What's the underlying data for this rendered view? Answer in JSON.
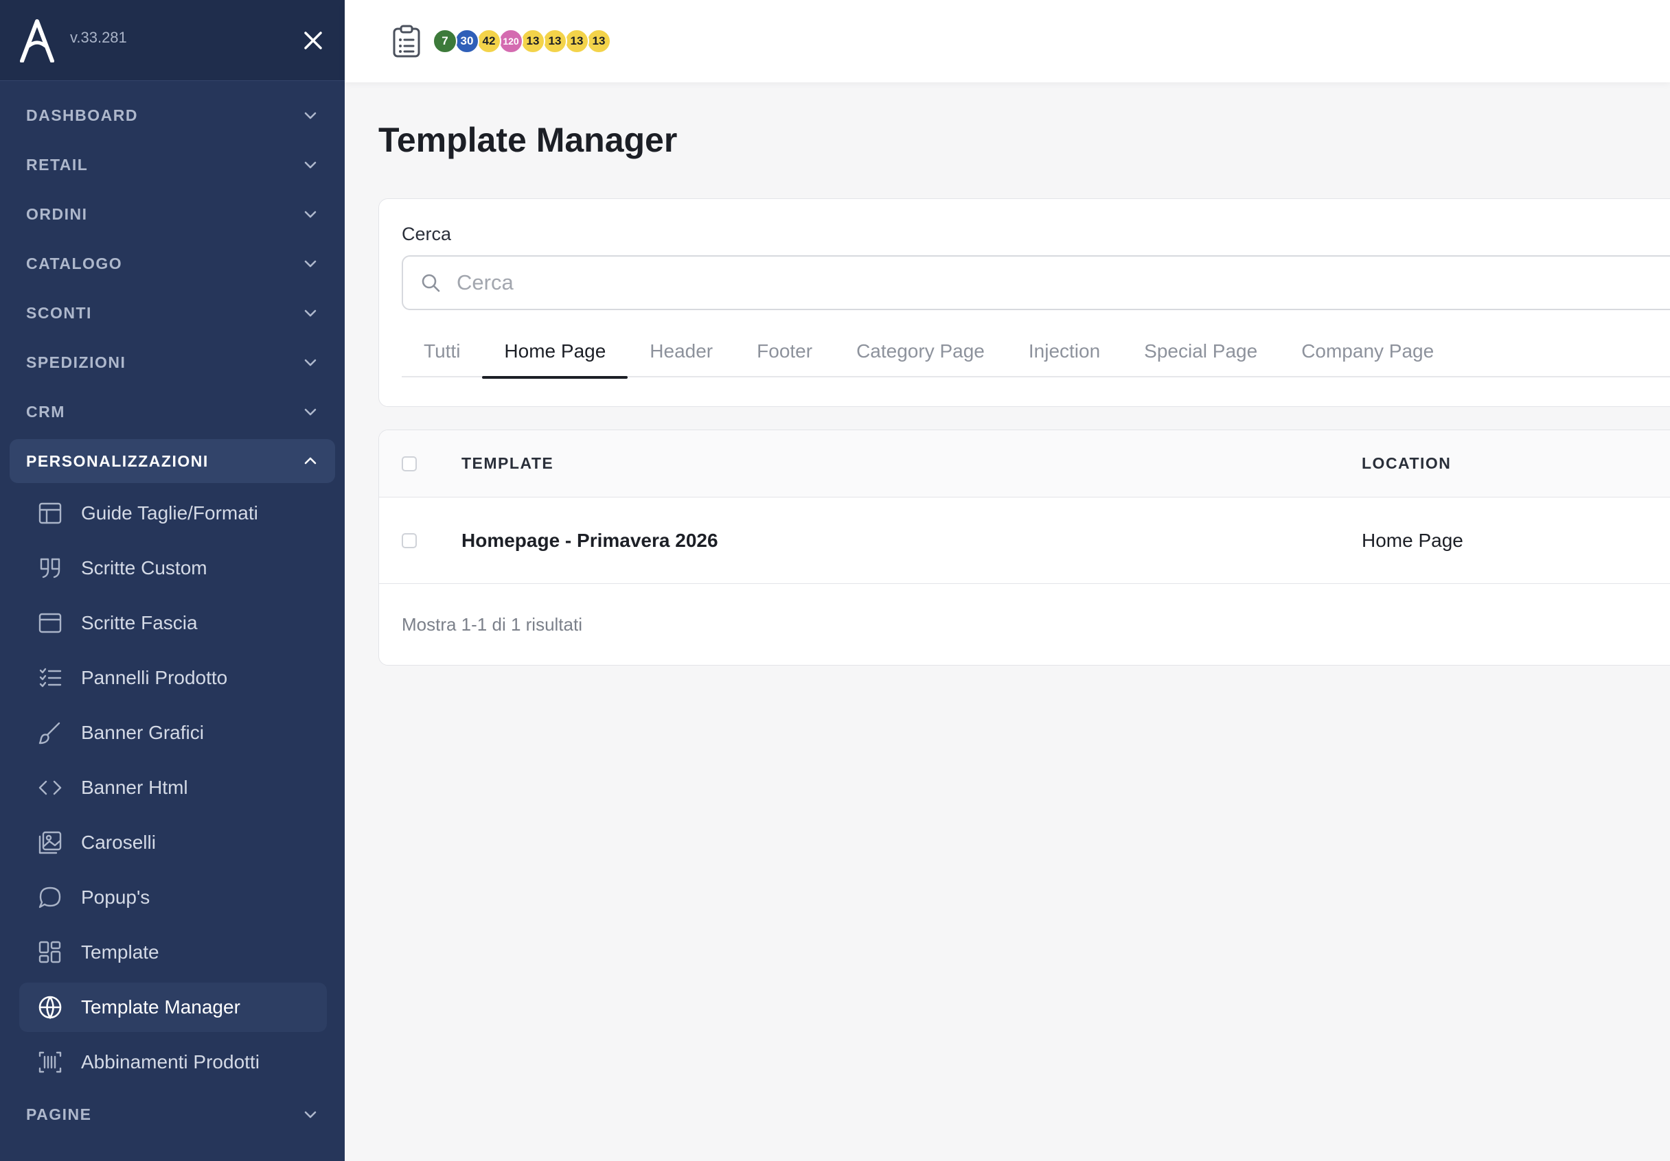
{
  "app": {
    "version": "v.33.281"
  },
  "sidebar": {
    "groups_top": [
      {
        "label": "DASHBOARD"
      },
      {
        "label": "RETAIL"
      },
      {
        "label": "ORDINI"
      },
      {
        "label": "CATALOGO"
      },
      {
        "label": "SCONTI"
      },
      {
        "label": "SPEDIZIONI"
      },
      {
        "label": "CRM"
      }
    ],
    "open_group": {
      "label": "PERSONALIZZAZIONI"
    },
    "sub_items": [
      {
        "label": "Guide Taglie/Formati",
        "icon": "table-icon"
      },
      {
        "label": "Scritte Custom",
        "icon": "quote-icon"
      },
      {
        "label": "Scritte Fascia",
        "icon": "panel-icon"
      },
      {
        "label": "Pannelli Prodotto",
        "icon": "list-icon"
      },
      {
        "label": "Banner Grafici",
        "icon": "brush-icon"
      },
      {
        "label": "Banner Html",
        "icon": "code-icon"
      },
      {
        "label": "Caroselli",
        "icon": "images-icon"
      },
      {
        "label": "Popup's",
        "icon": "chat-bubble-icon"
      },
      {
        "label": "Template",
        "icon": "layout-icon"
      },
      {
        "label": "Template Manager",
        "icon": "globe-icon",
        "active": true
      },
      {
        "label": "Abbinamenti Prodotti",
        "icon": "barcode-icon"
      }
    ],
    "groups_bottom": [
      {
        "label": "PAGINE"
      }
    ]
  },
  "topbar": {
    "badges": [
      {
        "value": "7",
        "color": "#3d7a3a",
        "text_color": "#ffffff"
      },
      {
        "value": "30",
        "color": "#2f5fb8",
        "text_color": "#ffffff"
      },
      {
        "value": "42",
        "color": "#f3d34a",
        "text_color": "#1c1f26"
      },
      {
        "value": "120",
        "color": "#d46bb0",
        "text_color": "#ffffff"
      },
      {
        "value": "13",
        "color": "#f3d34a",
        "text_color": "#1c1f26"
      },
      {
        "value": "13",
        "color": "#f3d34a",
        "text_color": "#1c1f26"
      },
      {
        "value": "13",
        "color": "#f3d34a",
        "text_color": "#1c1f26"
      },
      {
        "value": "13",
        "color": "#f3d34a",
        "text_color": "#1c1f26"
      }
    ]
  },
  "page": {
    "title": "Template Manager"
  },
  "search": {
    "label": "Cerca",
    "placeholder": "Cerca",
    "value": ""
  },
  "tabs": [
    {
      "label": "Tutti"
    },
    {
      "label": "Home Page",
      "active": true
    },
    {
      "label": "Header"
    },
    {
      "label": "Footer"
    },
    {
      "label": "Category Page"
    },
    {
      "label": "Injection"
    },
    {
      "label": "Special Page"
    },
    {
      "label": "Company Page"
    }
  ],
  "table": {
    "columns": {
      "template": "TEMPLATE",
      "location": "LOCATION"
    },
    "rows": [
      {
        "template": "Homepage - Primavera 2026",
        "location": "Home Page"
      }
    ],
    "footer": "Mostra 1-1 di 1 risultati"
  },
  "colors": {
    "sidebar_bg": "#26365a",
    "sidebar_head_bg": "#1f2d4c",
    "active_tab_underline": "#1c1f26"
  }
}
